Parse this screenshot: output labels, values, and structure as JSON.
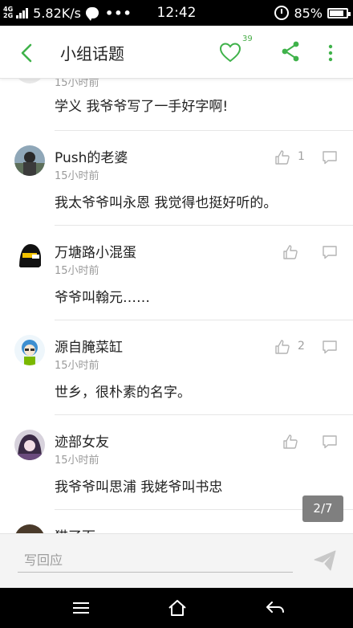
{
  "status_bar": {
    "network_top": "4G",
    "network_bottom": "2G",
    "speed": "5.82K/s",
    "more": "•••",
    "time": "12:42",
    "battery": "85%",
    "battery_level": 0.85
  },
  "header": {
    "back_icon": "chevron-left-icon",
    "title": "小组话题",
    "heart_icon": "heart-outline-icon",
    "like_count": "39",
    "share_icon": "share-icon",
    "menu_icon": "more-vertical-icon",
    "accent_color": "#3fb24a"
  },
  "first_comment": {
    "time_partial": "15小时前",
    "text": "学义 我爷爷写了一手好字啊!"
  },
  "comments": [
    {
      "name": "Push的老婆",
      "time": "15小时前",
      "text": "我太爷爷叫永恩 我觉得也挺好听的。",
      "likes": "1",
      "avatar": "avatar-photo-person"
    },
    {
      "name": "万塘路小混蛋",
      "time": "15小时前",
      "text": "爷爷叫翰元……",
      "likes": "",
      "avatar": "avatar-black-cartoon"
    },
    {
      "name": "源自腌菜缸",
      "time": "15小时前",
      "text": "世乡，很朴素的名字。",
      "likes": "2",
      "avatar": "avatar-cartoon-girl"
    },
    {
      "name": "迹部女友",
      "time": "15小时前",
      "text": "我爷爷叫思浦 我姥爷叫书忠",
      "likes": "",
      "avatar": "avatar-anime"
    }
  ],
  "next_comment": {
    "name": "猫了面"
  },
  "page_indicator": "2/7",
  "input": {
    "placeholder": "写回应",
    "send_icon": "send-icon"
  },
  "nav_bar": {
    "menu_icon": "menu-icon",
    "home_icon": "home-icon",
    "back_icon": "back-arrow-icon"
  }
}
